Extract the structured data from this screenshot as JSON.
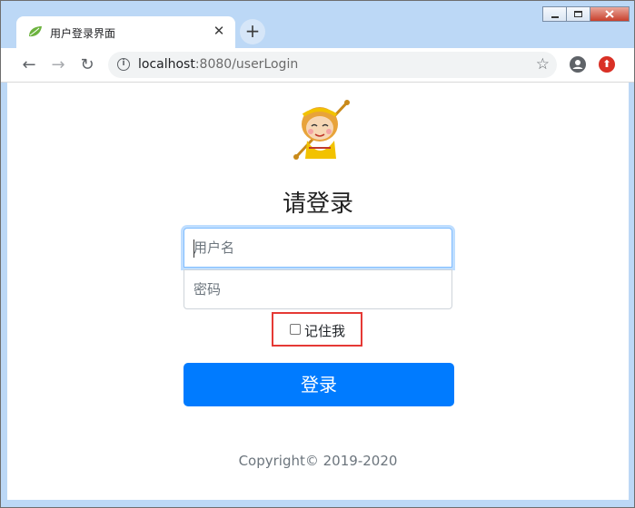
{
  "browser": {
    "tab_title": "用户登录界面",
    "tab_close": "✕",
    "new_tab": "+",
    "url_host": "localhost",
    "url_rest": ":8080/userLogin",
    "info_glyph": "i",
    "star_glyph": "☆",
    "ext_glyph": "⬆",
    "back_glyph": "←",
    "forward_glyph": "→",
    "reload_glyph": "↻"
  },
  "page": {
    "heading": "请登录",
    "username_placeholder": "用户名",
    "password_placeholder": "密码",
    "remember_label": "记住我",
    "login_button": "登录",
    "footer": "Copyright© 2019-2020"
  },
  "colors": {
    "primary": "#007bff",
    "highlight_border": "#e53935",
    "title_bar": "#bcd8f6"
  },
  "icons": {
    "favicon": "leaf-icon",
    "logo": "monkey-king-avatar"
  }
}
